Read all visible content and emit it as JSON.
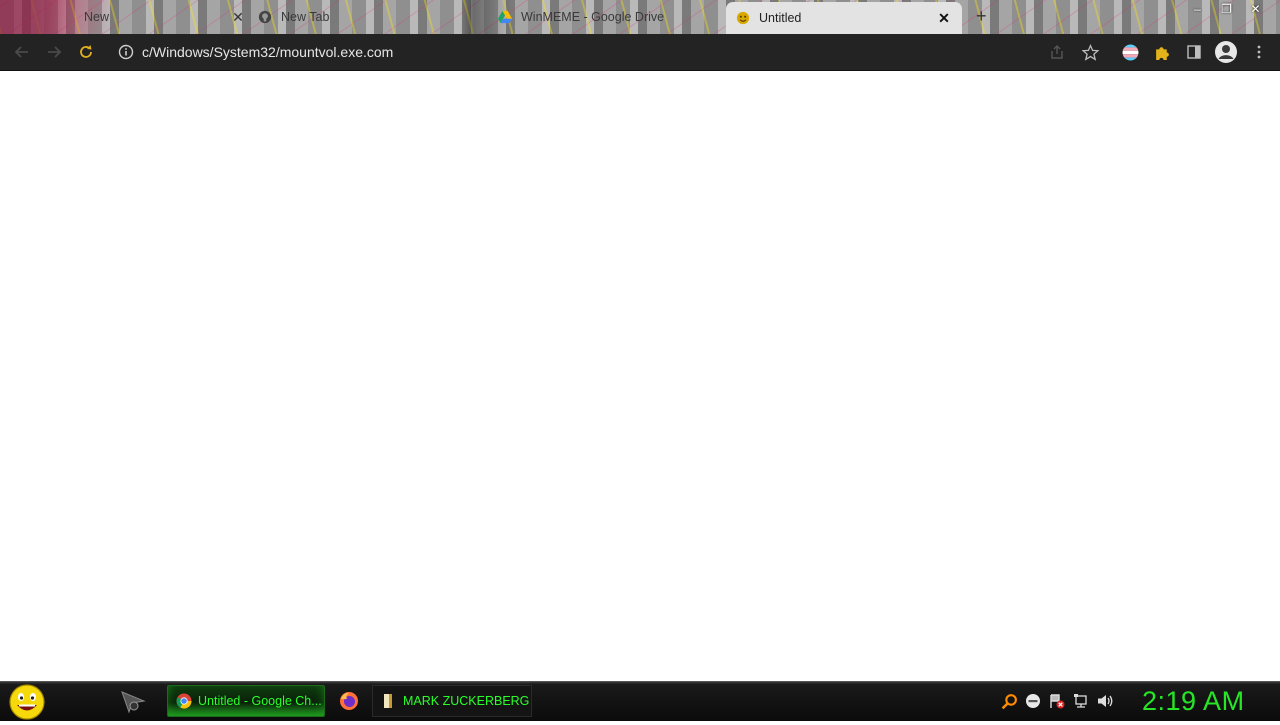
{
  "tabs": [
    {
      "title": "New",
      "icon": "generic-tab-icon"
    },
    {
      "title": "New Tab",
      "icon": "github-icon"
    },
    {
      "title": "WinMEME - Google Drive",
      "icon": "google-drive-icon"
    },
    {
      "title": "Untitled",
      "icon": "winmeme-icon",
      "active": true
    }
  ],
  "window_controls": {
    "minimize": "–",
    "maximize": "❐",
    "close": "✕",
    "new_tab": "+"
  },
  "tab_close_glyph": "✕",
  "omnibox": {
    "url": "c/Windows/System32/mountvol.exe.com"
  },
  "taskbar": {
    "tasks": [
      {
        "label": "Untitled - Google Ch...",
        "icon": "chrome-icon",
        "active": true
      },
      {
        "label": "MARK ZUCKERBERG",
        "icon": "document-icon",
        "active": false
      }
    ],
    "clock": "2:19 AM"
  },
  "colors": {
    "accent_green": "#26e626",
    "toolbar_bg": "#232323",
    "page_bg": "#ffffff"
  }
}
